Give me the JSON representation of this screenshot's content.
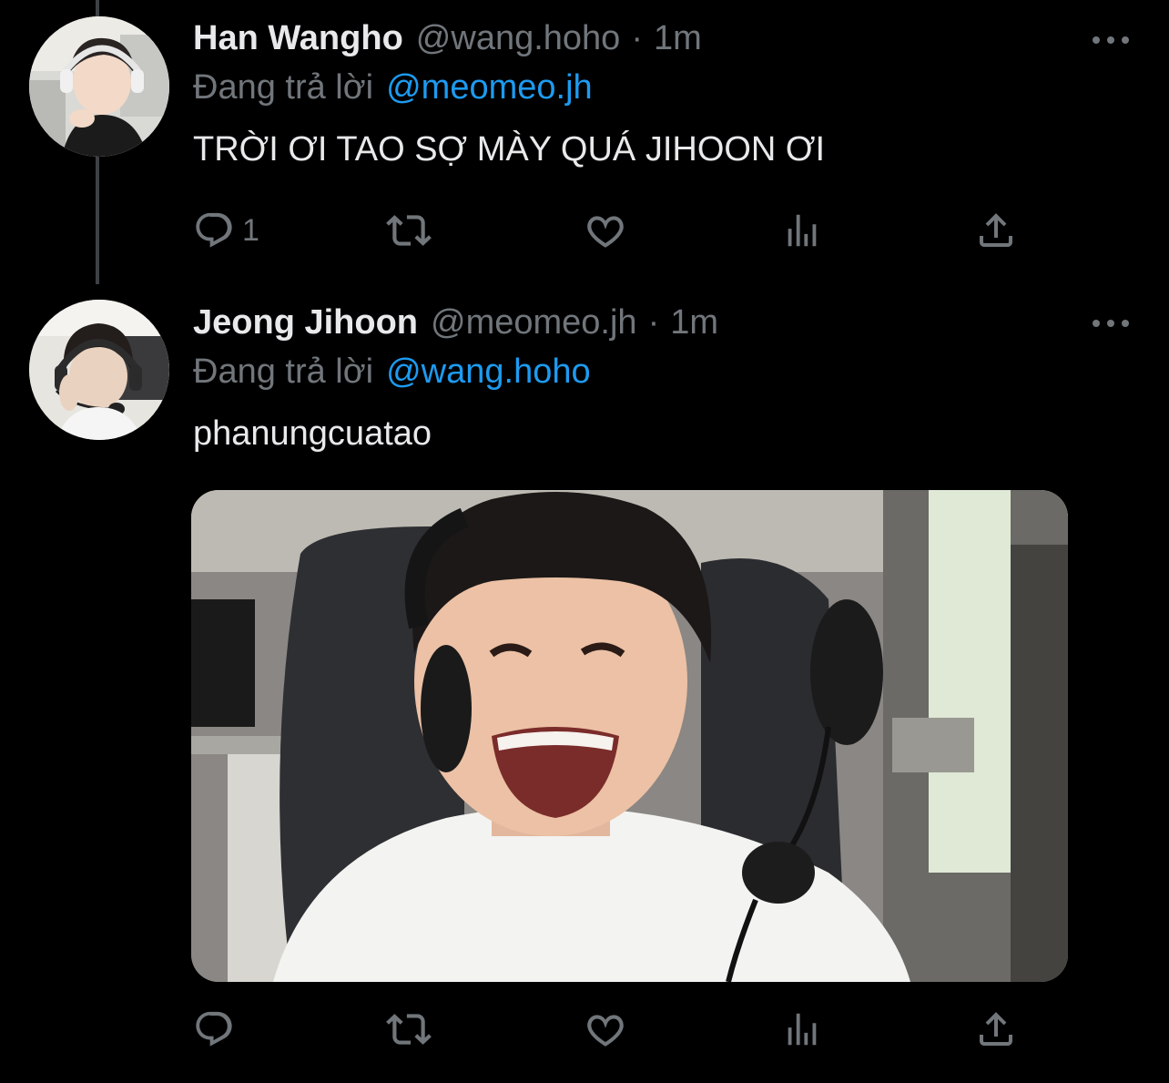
{
  "tweets": [
    {
      "display_name": "Han Wangho",
      "handle": "@wang.hoho",
      "separator": "·",
      "time": "1m",
      "reply_prefix": "Đang trả lời",
      "reply_to": "@meomeo.jh",
      "text": "TRỜI ƠI TAO SỢ MÀY QUÁ JIHOON ƠI",
      "reply_count": "1",
      "icons": [
        "reply-icon",
        "retweet-icon",
        "like-icon",
        "stats-icon",
        "share-icon",
        "more-icon"
      ]
    },
    {
      "display_name": "Jeong Jihoon",
      "handle": "@meomeo.jh",
      "separator": "·",
      "time": "1m",
      "reply_prefix": "Đang trả lời",
      "reply_to": "@wang.hoho",
      "text": "phanungcuatao",
      "reply_count": "",
      "has_media": true,
      "icons": [
        "reply-icon",
        "retweet-icon",
        "like-icon",
        "stats-icon",
        "share-icon",
        "more-icon"
      ]
    }
  ],
  "colors": {
    "background": "#000000",
    "primary_text": "#e7e9ea",
    "secondary_text": "#71767b",
    "link": "#1d9bf0",
    "thread_line": "#3e4144"
  }
}
